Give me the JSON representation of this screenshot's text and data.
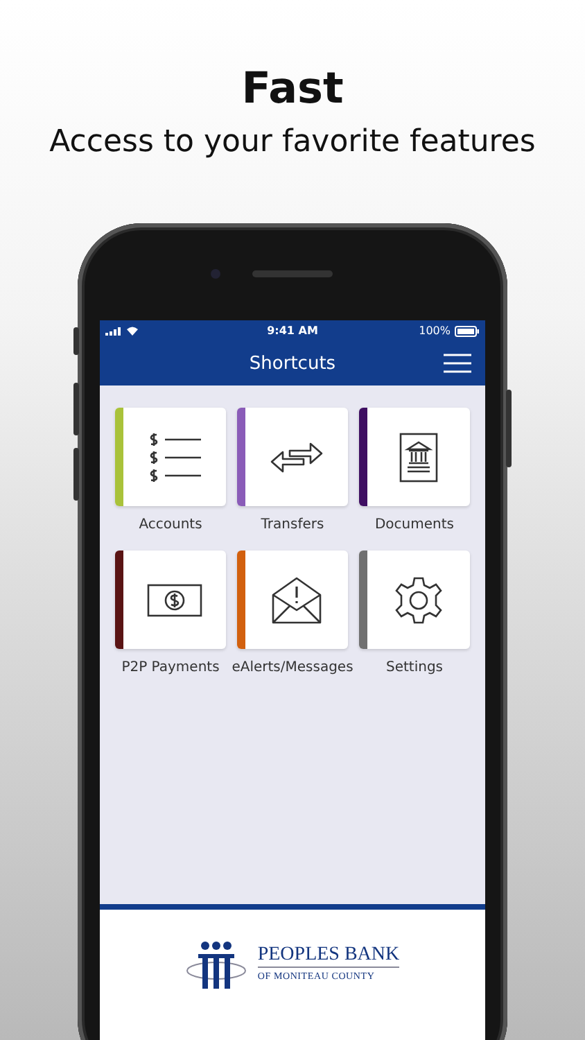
{
  "headline": "Fast",
  "subtitle": "Access to your favorite features",
  "status_bar": {
    "time": "9:41 AM",
    "battery": "100%"
  },
  "header": {
    "title": "Shortcuts"
  },
  "shortcuts": [
    {
      "label": "Accounts",
      "kind": "accounts",
      "color": "#a9c23a"
    },
    {
      "label": "Transfers",
      "kind": "transfers",
      "color": "#8a5cb8"
    },
    {
      "label": "Documents",
      "kind": "documents",
      "color": "#3f0f62"
    },
    {
      "label": "P2P Payments",
      "kind": "payments",
      "color": "#5a1414"
    },
    {
      "label": "eAlerts/Messages",
      "kind": "alerts",
      "color": "#d2600e"
    },
    {
      "label": "Settings",
      "kind": "settings",
      "color": "#707070"
    }
  ],
  "footer": {
    "bank_name": "PEOPLES BANK",
    "bank_subtitle": "OF MONITEAU COUNTY"
  }
}
